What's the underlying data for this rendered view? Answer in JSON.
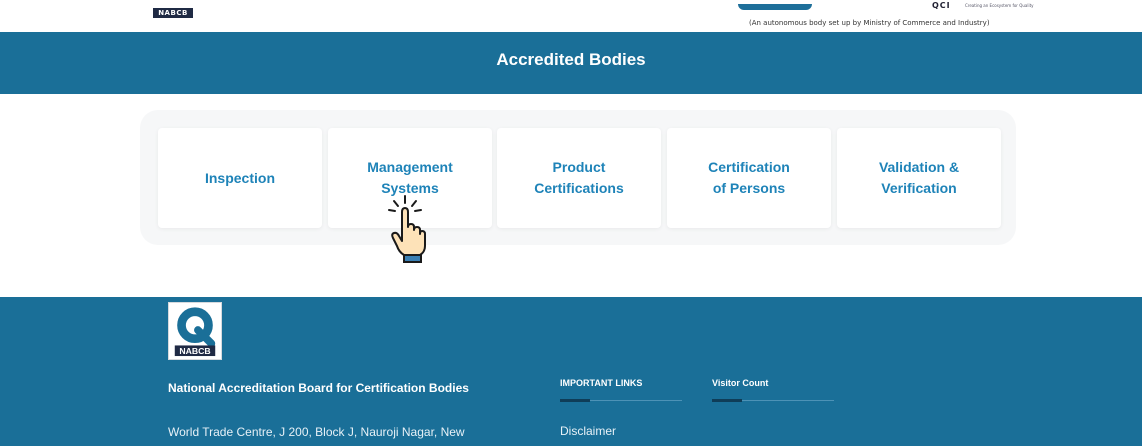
{
  "header": {
    "nabcb_label": "NABCB",
    "qci_label": "QCI",
    "qci_tagline": "Creating an Ecosystem for Quality",
    "autonomous_text": "(An autonomous body set up by Ministry of Commerce and Industry)"
  },
  "banner": {
    "title": "Accredited Bodies"
  },
  "cards": [
    {
      "label": "Inspection"
    },
    {
      "label": "Management\nSystems"
    },
    {
      "label": "Product\nCertifications"
    },
    {
      "label": "Certification\nof Persons"
    },
    {
      "label": "Validation &\nVerification"
    }
  ],
  "footer": {
    "logo_label": "NABCB",
    "org_name": "National Accreditation Board for Certification Bodies",
    "address": "World Trade Centre, J 200, Block J, Nauroji Nagar, New",
    "important_links_heading": "IMPORTANT LINKS",
    "visitor_count_heading": "Visitor Count",
    "links": [
      "Disclaimer"
    ]
  },
  "colors": {
    "primary_blue": "#1a6f98",
    "card_text": "#1e83b8"
  }
}
